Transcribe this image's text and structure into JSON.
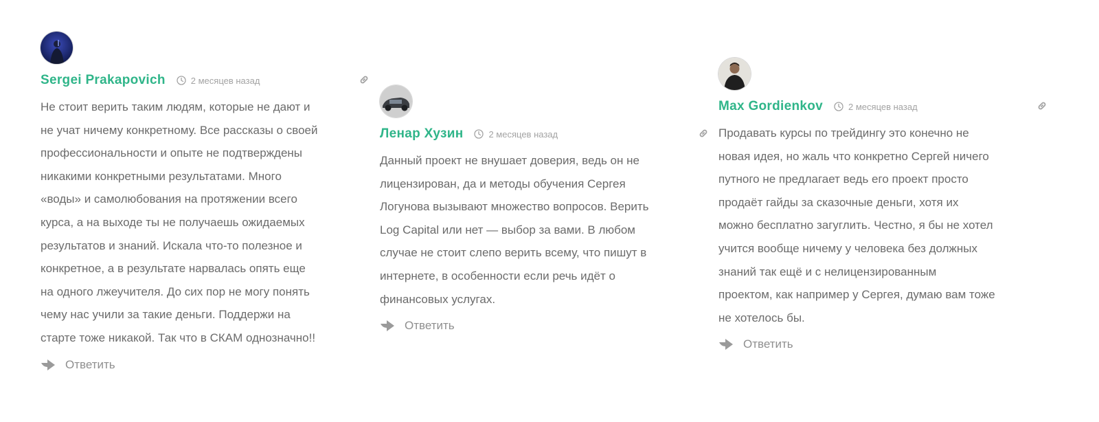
{
  "comments": [
    {
      "author": "Sergei Prakapovich",
      "time": "2 месяцев назад",
      "lines": [
        "Не стоит верить таким людям, которые не дают и",
        "не учат ничему конкретному. Все рассказы о своей",
        "профессиональности и опыте не подтверждены",
        "никакими конкретными результатами. Много",
        "«воды» и самолюбования на протяжении всего",
        "курса, а на выходе ты не получаешь ожидаемых",
        "результатов и знаний. Искала что-то полезное и",
        "конкретное, а в результате нарвалась опять еще",
        "на одного лжеучителя. До сих пор не могу понять",
        "чему нас учили за такие деньги. Поддержи на",
        "старте тоже никакой. Так что в СКАМ однозначно!!"
      ],
      "reply_label": "Ответить"
    },
    {
      "author": "Ленар Хузин",
      "time": "2 месяцев назад",
      "lines": [
        "Данный проект не внушает доверия, ведь он не",
        "лицензирован, да и методы обучения Сергея",
        "Логунова вызывают множество вопросов. Верить",
        "Log Capital или нет — выбор за вами. В любом",
        "случае не стоит слепо верить всему, что пишут в",
        "интернете, в особенности если речь идёт о",
        "финансовых услугах."
      ],
      "reply_label": "Ответить"
    },
    {
      "author": "Max Gordienkov",
      "time": "2 месяцев назад",
      "lines": [
        "Продавать курсы по трейдингу это конечно не",
        "новая идея, но жаль что конкретно Сергей ничего",
        "путного не предлагает ведь его проект просто",
        "продаёт гайды за сказочные деньги, хотя их",
        "можно бесплатно загуглить. Честно, я бы не хотел",
        "учится вообще ничему у человека без должных",
        "знаний так ещё и с нелицензированным",
        "проектом, как например у Сергея, думаю вам тоже",
        "не хотелось бы."
      ],
      "reply_label": "Ответить"
    }
  ],
  "colors": {
    "author": "#2fb589",
    "text": "#6b6b6b",
    "meta": "#a3a3a3",
    "reply": "#8f8f8f"
  },
  "icons": {
    "time": "clock-icon",
    "permalink": "link-icon",
    "reply": "reply-arrow-icon"
  }
}
